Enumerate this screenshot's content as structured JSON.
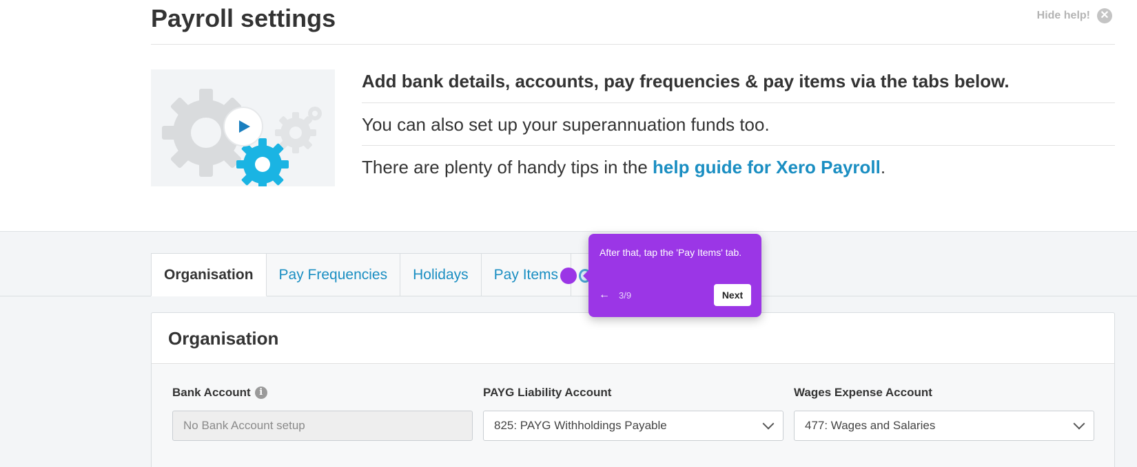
{
  "page": {
    "title": "Payroll settings",
    "hide_help_label": "Hide help!",
    "close_glyph": "✕"
  },
  "help": {
    "heading": "Add bank details, accounts, pay frequencies & pay items via the tabs below.",
    "line1": "You can also set up your superannuation funds too.",
    "line2_prefix": "There are plenty of handy tips in the ",
    "line2_link": "help guide for Xero Payroll",
    "line2_suffix": ".",
    "video_icon": "play-icon"
  },
  "tabs": [
    {
      "label": "Organisation",
      "active": true
    },
    {
      "label": "Pay Frequencies",
      "active": false
    },
    {
      "label": "Holidays",
      "active": false
    },
    {
      "label": "Pay Items",
      "active": false
    }
  ],
  "panel": {
    "title": "Organisation",
    "fields": [
      {
        "label": "Bank Account",
        "value": "No Bank Account setup",
        "disabled": true,
        "has_info": true,
        "info_glyph": "i"
      },
      {
        "label": "PAYG Liability Account",
        "value": "825: PAYG Withholdings Payable",
        "disabled": false
      },
      {
        "label": "Wages Expense Account",
        "value": "477: Wages and Salaries",
        "disabled": false
      }
    ]
  },
  "tooltip": {
    "text": "After that, tap the 'Pay Items' tab.",
    "back_glyph": "←",
    "counter": "3/9",
    "next_label": "Next",
    "color": "#9b36e6"
  },
  "colors": {
    "link": "#1a8ec2",
    "accent_gear": "#1ab4e3"
  }
}
